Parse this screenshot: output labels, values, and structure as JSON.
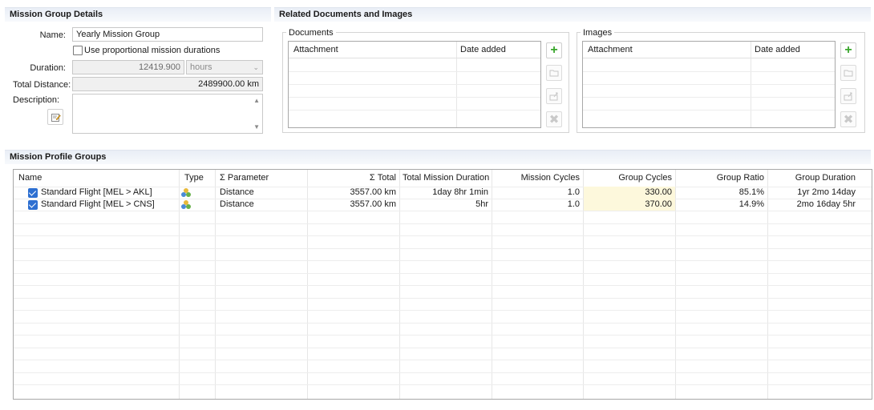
{
  "details": {
    "section_title": "Mission Group Details",
    "name_label": "Name:",
    "name_value": "Yearly Mission Group",
    "proportional_label": "Use proportional mission durations",
    "duration_label": "Duration:",
    "duration_value": "12419.900",
    "duration_unit": "hours",
    "total_distance_label": "Total Distance:",
    "total_distance_value": "2489900.00 km",
    "description_label": "Description:"
  },
  "related": {
    "section_title": "Related Documents and Images",
    "documents": {
      "title": "Documents",
      "columns": [
        "Attachment",
        "Date added"
      ]
    },
    "images": {
      "title": "Images",
      "columns": [
        "Attachment",
        "Date added"
      ]
    },
    "icons": {
      "add": "add-icon",
      "open": "open-folder-icon",
      "export": "export-icon",
      "delete": "delete-icon"
    }
  },
  "profiles": {
    "section_title": "Mission Profile Groups",
    "columns": [
      "Name",
      "Type",
      "Σ Parameter",
      "Σ Total",
      "Total Mission Duration",
      "Mission Cycles",
      "Group Cycles",
      "Group Ratio",
      "Group Duration"
    ],
    "rows": [
      {
        "name": "Standard Flight [MEL > AKL]",
        "type_icon": "mission-type-icon",
        "parameter": "Distance",
        "total": "3557.00 km",
        "duration": "1day 8hr 1min",
        "mission_cycles": "1.0",
        "group_cycles": "330.00",
        "group_ratio": "85.1%",
        "group_duration": "1yr 2mo 14day"
      },
      {
        "name": "Standard Flight [MEL > CNS]",
        "type_icon": "mission-type-icon",
        "parameter": "Distance",
        "total": "3557.00 km",
        "duration": "5hr",
        "mission_cycles": "1.0",
        "group_cycles": "370.00",
        "group_ratio": "14.9%",
        "group_duration": "2mo 16day 5hr"
      }
    ]
  },
  "colors": {
    "accent": "#2d6fd1",
    "highlight": "#fdf8dc",
    "add": "#3aa62c"
  }
}
